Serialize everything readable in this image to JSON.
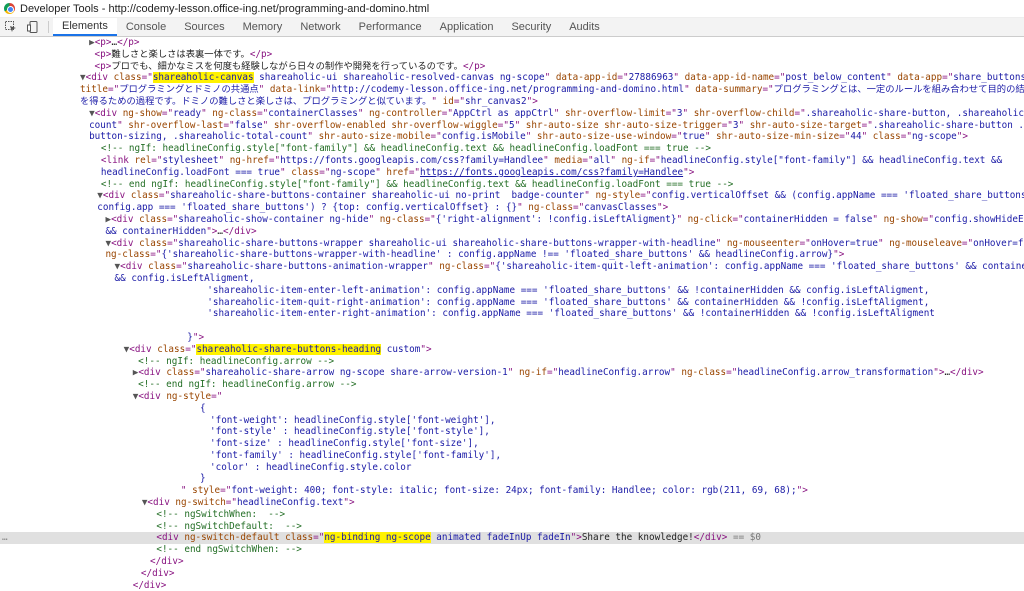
{
  "window": {
    "title": "Developer Tools - http://codemy-lesson.office-ing.net/programming-and-domino.html"
  },
  "toolbar": {
    "inspect_icon": "inspect-cursor-icon",
    "device_icon": "device-toggle-icon",
    "tabs": [
      "Elements",
      "Console",
      "Sources",
      "Memory",
      "Network",
      "Performance",
      "Application",
      "Security",
      "Audits"
    ],
    "active_tab": "Elements"
  },
  "dom_lines": [
    {
      "indent": 196,
      "html": "<span class='arr'>▶</span><span class='tag'>&lt;p&gt;</span><span class='tx'>…</span><span class='tag'>&lt;/p&gt;</span>"
    },
    {
      "indent": 208,
      "html": "<span class='tag'>&lt;p&gt;</span><span class='tx'>難しさと楽しさは表裏一体です。</span><span class='tag'>&lt;/p&gt;</span>"
    },
    {
      "indent": 208,
      "html": "<span class='tag'>&lt;p&gt;</span><span class='tx'>プロでも、細かなミスを何度も経験しながら日々の制作や開発を行っているのです。</span><span class='tag'>&lt;/p&gt;</span>"
    },
    {
      "indent": 176,
      "html": "<span class='arr'>▼</span><span class='tag'>&lt;div </span><span class='an'>class</span><span class='tag'>=\"</span><span class='av hl'>shareaholic-canvas</span><span class='av'> shareaholic-ui shareaholic-resolved-canvas ng-scope</span><span class='tag'>\" </span><span class='an'>data-app-id</span><span class='tag'>=\"</span><span class='av'>27886963</span><span class='tag'>\" </span><span class='an'>data-app-id-name</span><span class='tag'>=\"</span><span class='av'>post_below_content</span><span class='tag'>\" </span><span class='an'>data-app</span><span class='tag'>=\"</span><span class='av'>share_buttons</span><span class='tag'>\" </span><span class='an'>data-</span>"
    },
    {
      "indent": 176,
      "html": "<span class='an'>title</span><span class='tag'>=\"</span><span class='av'>プログラミングとドミノの共通点</span><span class='tag'>\" </span><span class='an'>data-link</span><span class='tag'>=\"</span><span class='av'>http://codemy-lesson.office-ing.net/programming-and-domino.html</span><span class='tag'>\" </span><span class='an'>data-summary</span><span class='tag'>=\"</span><span class='av'>プログラミングとは、一定のルールを組み合わせて目的の結果</span>"
    },
    {
      "indent": 176,
      "html": "<span class='av'>を得るための過程です。ドミノの難しさと楽しさは、プログラミングと似ています。</span><span class='tag'>\" </span><span class='an'>id</span><span class='tag'>=\"</span><span class='av'>shr_canvas2</span><span class='tag'>\"&gt;</span>"
    },
    {
      "indent": 196,
      "html": "<span class='arr'>▼</span><span class='tag'>&lt;div </span><span class='an'>ng-show</span><span class='tag'>=\"</span><span class='av'>ready</span><span class='tag'>\" </span><span class='an'>ng-class</span><span class='tag'>=\"</span><span class='av'>containerClasses</span><span class='tag'>\" </span><span class='an'>ng-controller</span><span class='tag'>=\"</span><span class='av'>AppCtrl as appCtrl</span><span class='tag'>\" </span><span class='an'>shr-overflow-limit</span><span class='tag'>=\"</span><span class='av'>3</span><span class='tag'>\" </span><span class='an'>shr-overflow-child</span><span class='tag'>=\"</span><span class='av'>.shareaholic-share-button, .shareaholic-total-</span>"
    },
    {
      "indent": 196,
      "html": "<span class='av'>count</span><span class='tag'>\" </span><span class='an'>shr-overflow-last</span><span class='tag'>=\"</span><span class='av'>false</span><span class='tag'>\" </span><span class='an'>shr-overflow-enabled</span><span class='tag'> </span><span class='an'>shr-overflow-wiggle</span><span class='tag'>=\"</span><span class='av'>5</span><span class='tag'>\" </span><span class='an'>shr-auto-size</span><span class='tag'> </span><span class='an'>shr-auto-size-trigger</span><span class='tag'>=\"</span><span class='av'>3</span><span class='tag'>\" </span><span class='an'>shr-auto-size-target</span><span class='tag'>=\"</span><span class='av'>.shareaholic-share-button .share-</span>"
    },
    {
      "indent": 196,
      "html": "<span class='av'>button-sizing, .shareaholic-total-count</span><span class='tag'>\" </span><span class='an'>shr-auto-size-mobile</span><span class='tag'>=\"</span><span class='av'>config.isMobile</span><span class='tag'>\" </span><span class='an'>shr-auto-size-use-window</span><span class='tag'>=\"</span><span class='av'>true</span><span class='tag'>\" </span><span class='an'>shr-auto-size-min-size</span><span class='tag'>=\"</span><span class='av'>44</span><span class='tag'>\" </span><span class='an'>class</span><span class='tag'>=\"</span><span class='av'>ng-scope</span><span class='tag'>\"&gt;</span>"
    },
    {
      "indent": 222,
      "html": "<span class='cm'>&lt;!-- ngIf: headlineConfig.style[\"font-family\"] &amp;&amp; headlineConfig.text &amp;&amp; headlineConfig.loadFont === true --&gt;</span>"
    },
    {
      "indent": 222,
      "html": "<span class='tag'>&lt;link </span><span class='an'>rel</span><span class='tag'>=\"</span><span class='av'>stylesheet</span><span class='tag'>\" </span><span class='an'>ng-href</span><span class='tag'>=\"</span><span class='av'>https://fonts.googleapis.com/css?family=Handlee</span><span class='tag'>\" </span><span class='an'>media</span><span class='tag'>=\"</span><span class='av'>all</span><span class='tag'>\" </span><span class='an'>ng-if</span><span class='tag'>=\"</span><span class='av'>headlineConfig.style[\"font-family\"] &amp;&amp; headlineConfig.text &amp;&amp;</span>"
    },
    {
      "indent": 222,
      "html": "<span class='av'>headlineConfig.loadFont === true</span><span class='tag'>\" </span><span class='an'>class</span><span class='tag'>=\"</span><span class='av'>ng-scope</span><span class='tag'>\" </span><span class='an'>href</span><span class='tag'>=\"</span><span class='lk'>https://fonts.googleapis.com/css?family=Handlee</span><span class='tag'>\"&gt;</span>"
    },
    {
      "indent": 222,
      "html": "<span class='cm'>&lt;!-- end ngIf: headlineConfig.style[\"font-family\"] &amp;&amp; headlineConfig.text &amp;&amp; headlineConfig.loadFont === true --&gt;</span>"
    },
    {
      "indent": 214,
      "html": "<span class='arr'>▼</span><span class='tag'>&lt;div </span><span class='an'>class</span><span class='tag'>=\"</span><span class='av'>shareaholic-share-buttons-container shareaholic-ui no-print  badge-counter</span><span class='tag'>\" </span><span class='an'>ng-style</span><span class='tag'>=\"</span><span class='av'>config.verticalOffset &amp;&amp; (config.appName === 'floated_share_buttons' ||</span>"
    },
    {
      "indent": 214,
      "html": "<span class='av'>config.app === 'floated_share_buttons') ? {top: config.verticalOffset} : {}</span><span class='tag'>\" </span><span class='an'>ng-class</span><span class='tag'>=\"</span><span class='av'>canvasClasses</span><span class='tag'>\"&gt;</span>"
    },
    {
      "indent": 232,
      "html": "<span class='arr'>▶</span><span class='tag'>&lt;div </span><span class='an'>class</span><span class='tag'>=\"</span><span class='av'>shareaholic-show-container ng-hide</span><span class='tag'>\" </span><span class='an'>ng-class</span><span class='tag'>=\"</span><span class='av'>{'right-alignment': !config.isLeftAligment}</span><span class='tag'>\" </span><span class='an'>ng-click</span><span class='tag'>=\"</span><span class='av'>containerHidden = false</span><span class='tag'>\" </span><span class='an'>ng-show</span><span class='tag'>=\"</span><span class='av'>config.showHideEnabled</span>"
    },
    {
      "indent": 232,
      "html": "<span class='av'>&amp;&amp; containerHidden</span><span class='tag'>\"&gt;</span><span class='tx'>…</span><span class='tag'>&lt;/div&gt;</span>"
    },
    {
      "indent": 232,
      "html": "<span class='arr'>▼</span><span class='tag'>&lt;div </span><span class='an'>class</span><span class='tag'>=\"</span><span class='av'>shareaholic-share-buttons-wrapper shareaholic-ui shareaholic-share-buttons-wrapper-with-headline</span><span class='tag'>\" </span><span class='an'>ng-mouseenter</span><span class='tag'>=\"</span><span class='av'>onHover=true</span><span class='tag'>\" </span><span class='an'>ng-mouseleave</span><span class='tag'>=\"</span><span class='av'>onHover=false</span><span class='tag'>\"</span>"
    },
    {
      "indent": 232,
      "html": "<span class='an'>ng-class</span><span class='tag'>=\"</span><span class='av'>{'shareaholic-share-buttons-wrapper-with-headline' : config.appName !== 'floated_share_buttons' &amp;&amp; headlineConfig.arrow}</span><span class='tag'>\"&gt;</span>"
    },
    {
      "indent": 252,
      "html": "<span class='arr'>▼</span><span class='tag'>&lt;div </span><span class='an'>class</span><span class='tag'>=\"</span><span class='av'>shareaholic-share-buttons-animation-wrapper</span><span class='tag'>\" </span><span class='an'>ng-class</span><span class='tag'>=\"</span><span class='av'>{'shareaholic-item-quit-left-animation': config.appName === 'floated_share_buttons' &amp;&amp; containerHidden</span>"
    },
    {
      "indent": 252,
      "html": "<span class='av'>&amp;&amp; config.isLeftAligment,</span>"
    },
    {
      "indent": 456,
      "html": "<span class='av'>'shareaholic-item-enter-left-animation': config.appName === 'floated_share_buttons' &amp;&amp; !containerHidden &amp;&amp; config.isLeftAligment,</span>"
    },
    {
      "indent": 456,
      "html": "<span class='av'>'shareaholic-item-quit-right-animation': config.appName === 'floated_share_buttons' &amp;&amp; containerHidden &amp;&amp; !config.isLeftAligment,</span>"
    },
    {
      "indent": 456,
      "html": "<span class='av'>'shareaholic-item-enter-right-animation': config.appName === 'floated_share_buttons' &amp;&amp; !containerHidden &amp;&amp; !config.isLeftAligment</span>"
    },
    {
      "indent": 0,
      "html": ""
    },
    {
      "indent": 412,
      "html": "<span class='av'>}</span><span class='tag'>\"&gt;</span>"
    },
    {
      "indent": 272,
      "html": "<span class='arr'>▼</span><span class='tag'>&lt;div </span><span class='an'>class</span><span class='tag'>=\"</span><span class='av hl'>shareaholic-share-buttons-heading</span><span class='av'> custom</span><span class='tag'>\"&gt;</span>"
    },
    {
      "indent": 304,
      "html": "<span class='cm'>&lt;!-- ngIf: headlineConfig.arrow --&gt;</span>"
    },
    {
      "indent": 292,
      "html": "<span class='arr'>▶</span><span class='tag'>&lt;div </span><span class='an'>class</span><span class='tag'>=\"</span><span class='av'>shareaholic-share-arrow ng-scope share-arrow-version-1</span><span class='tag'>\" </span><span class='an'>ng-if</span><span class='tag'>=\"</span><span class='av'>headlineConfig.arrow</span><span class='tag'>\" </span><span class='an'>ng-class</span><span class='tag'>=\"</span><span class='av'>headlineConfig.arrow_transformation</span><span class='tag'>\"&gt;</span><span class='tx'>…</span><span class='tag'>&lt;/div&gt;</span>"
    },
    {
      "indent": 304,
      "html": "<span class='cm'>&lt;!-- end ngIf: headlineConfig.arrow --&gt;</span>"
    },
    {
      "indent": 292,
      "html": "<span class='arr'>▼</span><span class='tag'>&lt;div </span><span class='an'>ng-style</span><span class='tag'>=\"</span>"
    },
    {
      "indent": 440,
      "html": "<span class='av'>{</span>"
    },
    {
      "indent": 462,
      "html": "<span class='av'>'font-weight': headlineConfig.style['font-weight'],</span>"
    },
    {
      "indent": 462,
      "html": "<span class='av'>'font-style' : headlineConfig.style['font-style'],</span>"
    },
    {
      "indent": 462,
      "html": "<span class='av'>'font-size' : headlineConfig.style['font-size'],</span>"
    },
    {
      "indent": 462,
      "html": "<span class='av'>'font-family' : headlineConfig.style['font-family'],</span>"
    },
    {
      "indent": 462,
      "html": "<span class='av'>'color' : headlineConfig.style.color</span>"
    },
    {
      "indent": 440,
      "html": "<span class='av'>}</span>"
    },
    {
      "indent": 398,
      "html": "<span class='tag'>\" </span><span class='an'>style</span><span class='tag'>=\"</span><span class='av'>font-weight: 400; font-style: italic; font-size: 24px; font-family: Handlee; color: rgb(211, 69, 68);</span><span class='tag'>\"&gt;</span>"
    },
    {
      "indent": 312,
      "html": "<span class='arr'>▼</span><span class='tag'>&lt;div </span><span class='an'>ng-switch</span><span class='tag'>=\"</span><span class='av'>headlineConfig.text</span><span class='tag'>\"&gt;</span>"
    },
    {
      "indent": 344,
      "html": "<span class='cm'>&lt;!-- ngSwitchWhen:  --&gt;</span>"
    },
    {
      "indent": 344,
      "html": "<span class='cm'>&lt;!-- ngSwitchDefault:  --&gt;</span>"
    },
    {
      "indent": 344,
      "sel": true,
      "html": "<span class='tag'>&lt;div </span><span class='an'>ng-switch-default</span><span class='tag'> </span><span class='an'>class</span><span class='tag'>=\"</span><span class='av hl'>ng-binding ng-scope</span><span class='av'> animated fadeInUp fadeIn</span><span class='tag'>\"&gt;</span><span class='tx'>Share the knowledge!</span><span class='tag'>&lt;/div&gt;</span><span class='eq'> == $0</span>"
    },
    {
      "indent": 344,
      "html": "<span class='cm'>&lt;!-- end ngSwitchWhen: --&gt;</span>"
    },
    {
      "indent": 330,
      "html": "<span class='tag'>&lt;/div&gt;</span>"
    },
    {
      "indent": 310,
      "html": "<span class='tag'>&lt;/div&gt;</span>"
    },
    {
      "indent": 292,
      "html": "<span class='tag'>&lt;/div&gt;</span>"
    }
  ]
}
